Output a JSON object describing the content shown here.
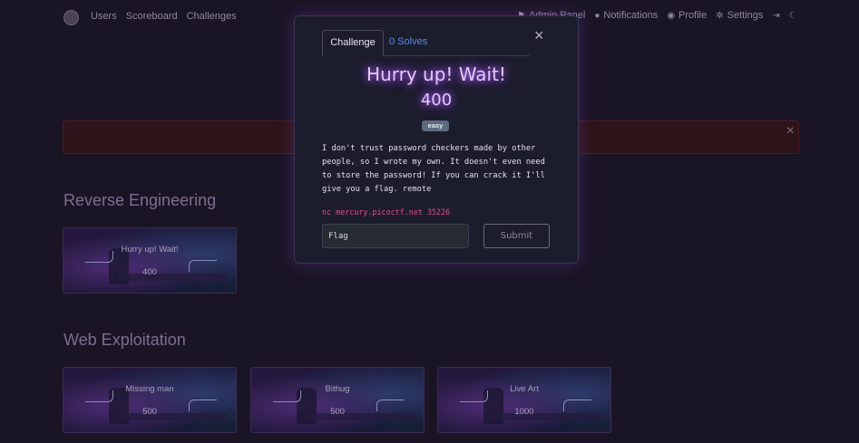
{
  "nav": {
    "left": [
      "Users",
      "Scoreboard",
      "Challenges"
    ],
    "admin_label": "Admin Panel",
    "notifications_label": "Notifications",
    "profile_label": "Profile",
    "settings_label": "Settings"
  },
  "alert": {
    "close_glyph": "×"
  },
  "categories": [
    {
      "title": "Reverse Engineering"
    },
    {
      "title": "Web Exploitation"
    }
  ],
  "cards": [
    {
      "name": "Hurry up! Wait!",
      "points": "400"
    },
    {
      "name": "Missing man",
      "points": "500"
    },
    {
      "name": "Bithug",
      "points": "500"
    },
    {
      "name": "Live Art",
      "points": "1000"
    }
  ],
  "modal": {
    "tab_challenge": "Challenge",
    "tab_solves": "0 Solves",
    "close_glyph": "×",
    "title": "Hurry up! Wait!",
    "value": "400",
    "tag": "easy",
    "description": "I don't trust password checkers made by other people, so I wrote my own. It doesn't even need to store the password! If you can crack it I'll give you a flag. remote",
    "connection": "nc mercury.picoctf.net 35226",
    "flag_placeholder": "Flag",
    "submit_label": "Submit"
  },
  "colors": {
    "background": "#1a1525",
    "modal_bg": "#1c1d2c",
    "title_glow": "#b56cff",
    "link_blue": "#4f8ee8",
    "connection_pink": "#e24d84",
    "badge": "#5d6b80"
  },
  "icons": [
    "logo-icon",
    "flag-icon",
    "bell-icon",
    "user-icon",
    "gears-icon",
    "sign-out-icon",
    "moon-icon",
    "close-icon"
  ]
}
